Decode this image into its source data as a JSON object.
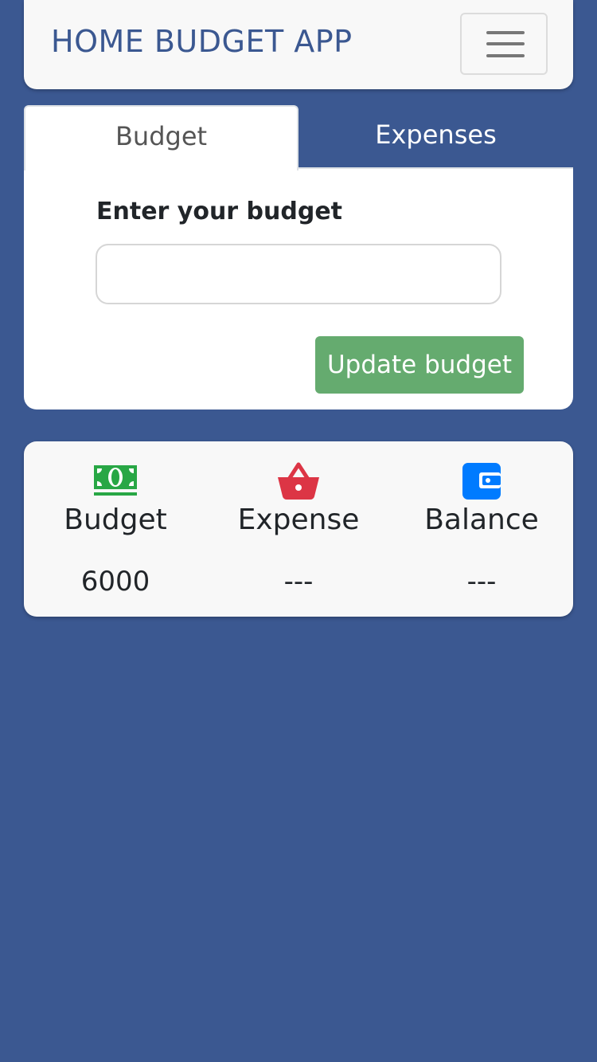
{
  "navbar": {
    "brand": "HOME BUDGET APP",
    "menu_icon": "hamburger-menu-icon"
  },
  "tabs": [
    {
      "label": "Budget",
      "active": true
    },
    {
      "label": "Expenses",
      "active": false
    }
  ],
  "budget_form": {
    "label": "Enter your budget",
    "input_value": "",
    "button_label": "Update budget"
  },
  "summary": [
    {
      "icon": "money-bill-icon",
      "label": "Budget",
      "value": "6000",
      "color": "#28a745"
    },
    {
      "icon": "shopping-basket-icon",
      "label": "Expense",
      "value": "---",
      "color": "#dc3545"
    },
    {
      "icon": "wallet-icon",
      "label": "Balance",
      "value": "---",
      "color": "#007bff"
    }
  ],
  "colors": {
    "background": "#3b5891",
    "brand": "#3b5891",
    "update_button": "#65ab6f"
  }
}
